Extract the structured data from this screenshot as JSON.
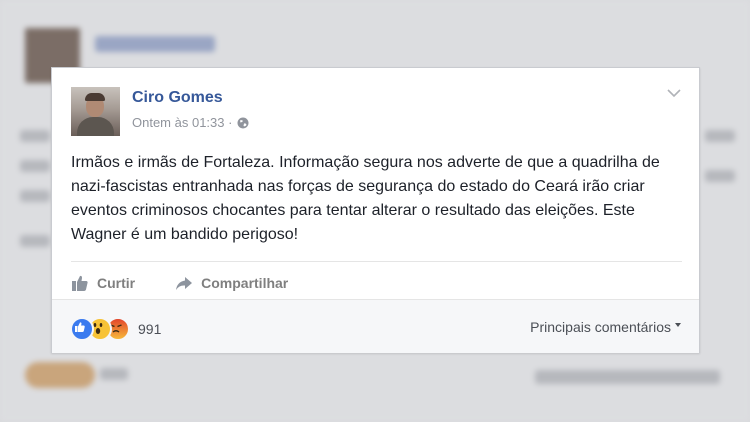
{
  "post": {
    "author": "Ciro Gomes",
    "timestamp": "Ontem às 01:33 ·",
    "text": "Irmãos e irmãs de Fortaleza. Informação segura nos adverte de que a quadrilha de nazi-fascistas entranhada nas forças de segurança do estado do Ceará irão criar eventos criminosos chocantes para tentar alterar o resultado das eleições. Este Wagner é um bandido perigoso!",
    "privacy_icon": "globe-icon",
    "menu_icon": "chevron-down-icon"
  },
  "actions": {
    "like_label": "Curtir",
    "share_label": "Compartilhar"
  },
  "footer": {
    "reactions": [
      "like",
      "wow",
      "angry"
    ],
    "reaction_count": "991",
    "sort_label": "Principais comentários"
  },
  "colors": {
    "name": "#365899",
    "like": "#3b7bef",
    "wow": "#f7c337",
    "angry": "#ee6d3a"
  }
}
